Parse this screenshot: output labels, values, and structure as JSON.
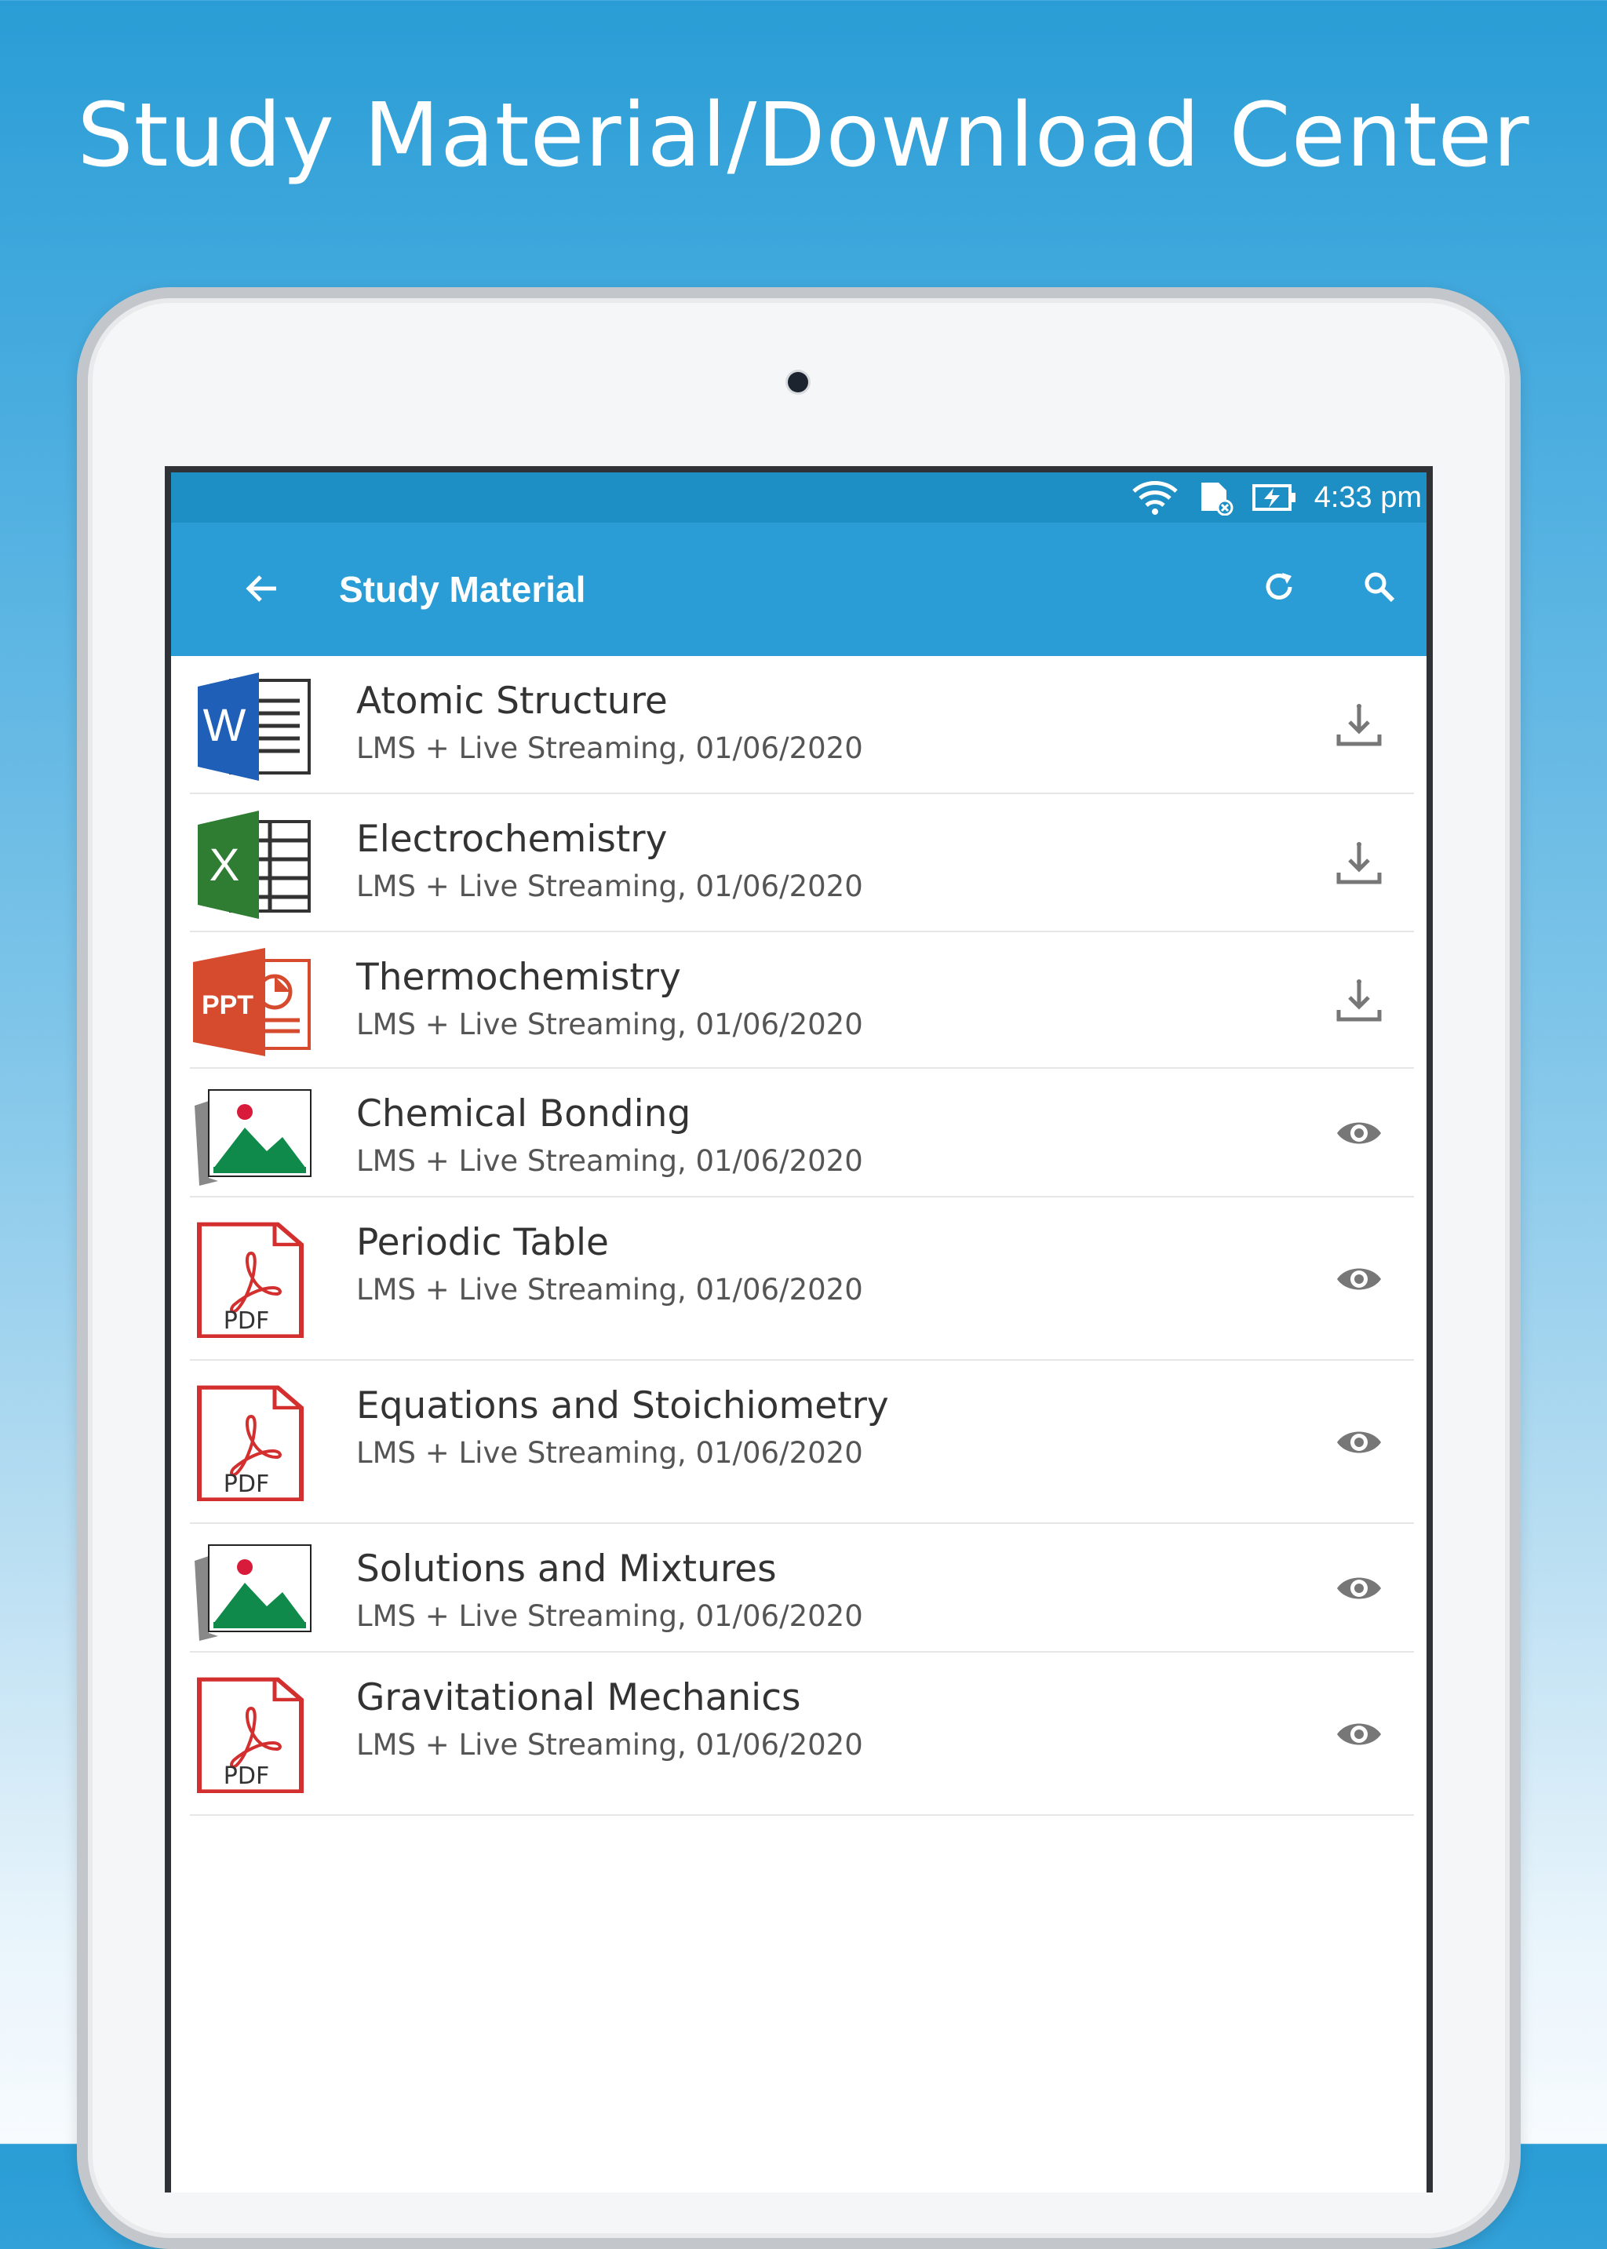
{
  "headline": "Study Material/Download Center",
  "status_bar": {
    "time": "4:33 pm"
  },
  "app_bar": {
    "title": "Study Material"
  },
  "colors": {
    "primary": "#2a9dd6",
    "status_bar": "#1e8fc4",
    "word": "#1f5fb8",
    "excel": "#2e7d32",
    "ppt": "#d64a2e",
    "pdf": "#d32f2f",
    "image": "#0f8a4a"
  },
  "items": [
    {
      "title": "Atomic Structure",
      "subtitle": "LMS + Live Streaming, 01/06/2020",
      "type": "word",
      "icon_label": "W",
      "action": "download"
    },
    {
      "title": "Electrochemistry",
      "subtitle": "LMS + Live Streaming, 01/06/2020",
      "type": "excel",
      "icon_label": "X",
      "action": "download"
    },
    {
      "title": "Thermochemistry",
      "subtitle": "LMS + Live Streaming, 01/06/2020",
      "type": "ppt",
      "icon_label": "PPT",
      "action": "download"
    },
    {
      "title": "Chemical Bonding",
      "subtitle": "LMS + Live Streaming, 01/06/2020",
      "type": "image",
      "icon_label": "",
      "action": "view"
    },
    {
      "title": "Periodic Table",
      "subtitle": "LMS + Live Streaming, 01/06/2020",
      "type": "pdf",
      "icon_label": "PDF",
      "action": "view"
    },
    {
      "title": "Equations and Stoichiometry",
      "subtitle": "LMS + Live Streaming, 01/06/2020",
      "type": "pdf",
      "icon_label": "PDF",
      "action": "view"
    },
    {
      "title": "Solutions and Mixtures",
      "subtitle": "LMS + Live Streaming, 01/06/2020",
      "type": "image",
      "icon_label": "",
      "action": "view"
    },
    {
      "title": "Gravitational Mechanics",
      "subtitle": "LMS + Live Streaming, 01/06/2020",
      "type": "pdf",
      "icon_label": "PDF",
      "action": "view"
    }
  ]
}
